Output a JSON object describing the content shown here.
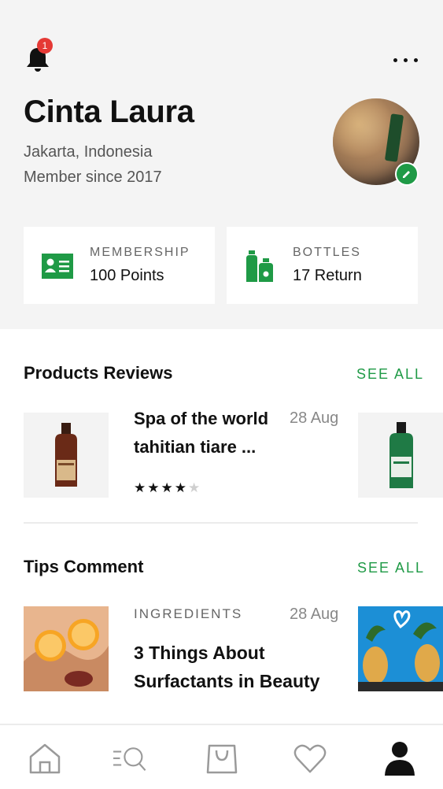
{
  "profile": {
    "name": "Cinta Laura",
    "location": "Jakarta, Indonesia",
    "member_since": "Member since 2017",
    "notification_count": "1"
  },
  "stats": [
    {
      "label": "MEMBERSHIP",
      "value": "100 Points",
      "icon": "id-card-icon"
    },
    {
      "label": "BOTTLES",
      "value": "17 Return",
      "icon": "bottles-icon"
    }
  ],
  "reviews": {
    "title": "Products Reviews",
    "see_all": "SEE ALL",
    "items": [
      {
        "title": "Spa of the world tahitian tiare ...",
        "date": "28 Aug",
        "rating": 4,
        "rating_max": 5
      }
    ]
  },
  "tips": {
    "title": "Tips Comment",
    "see_all": "SEE ALL",
    "items": [
      {
        "category": "INGREDIENTS",
        "title": "3 Things About Surfactants in Beauty",
        "date": "28 Aug"
      }
    ]
  },
  "tabbar": {
    "tabs": [
      "home-icon",
      "search-icon",
      "bag-icon",
      "heart-icon",
      "profile-icon"
    ],
    "active": "profile-icon"
  },
  "colors": {
    "accent": "#1f9a46",
    "badge": "#e53935",
    "header_bg": "#f4f4f4"
  }
}
